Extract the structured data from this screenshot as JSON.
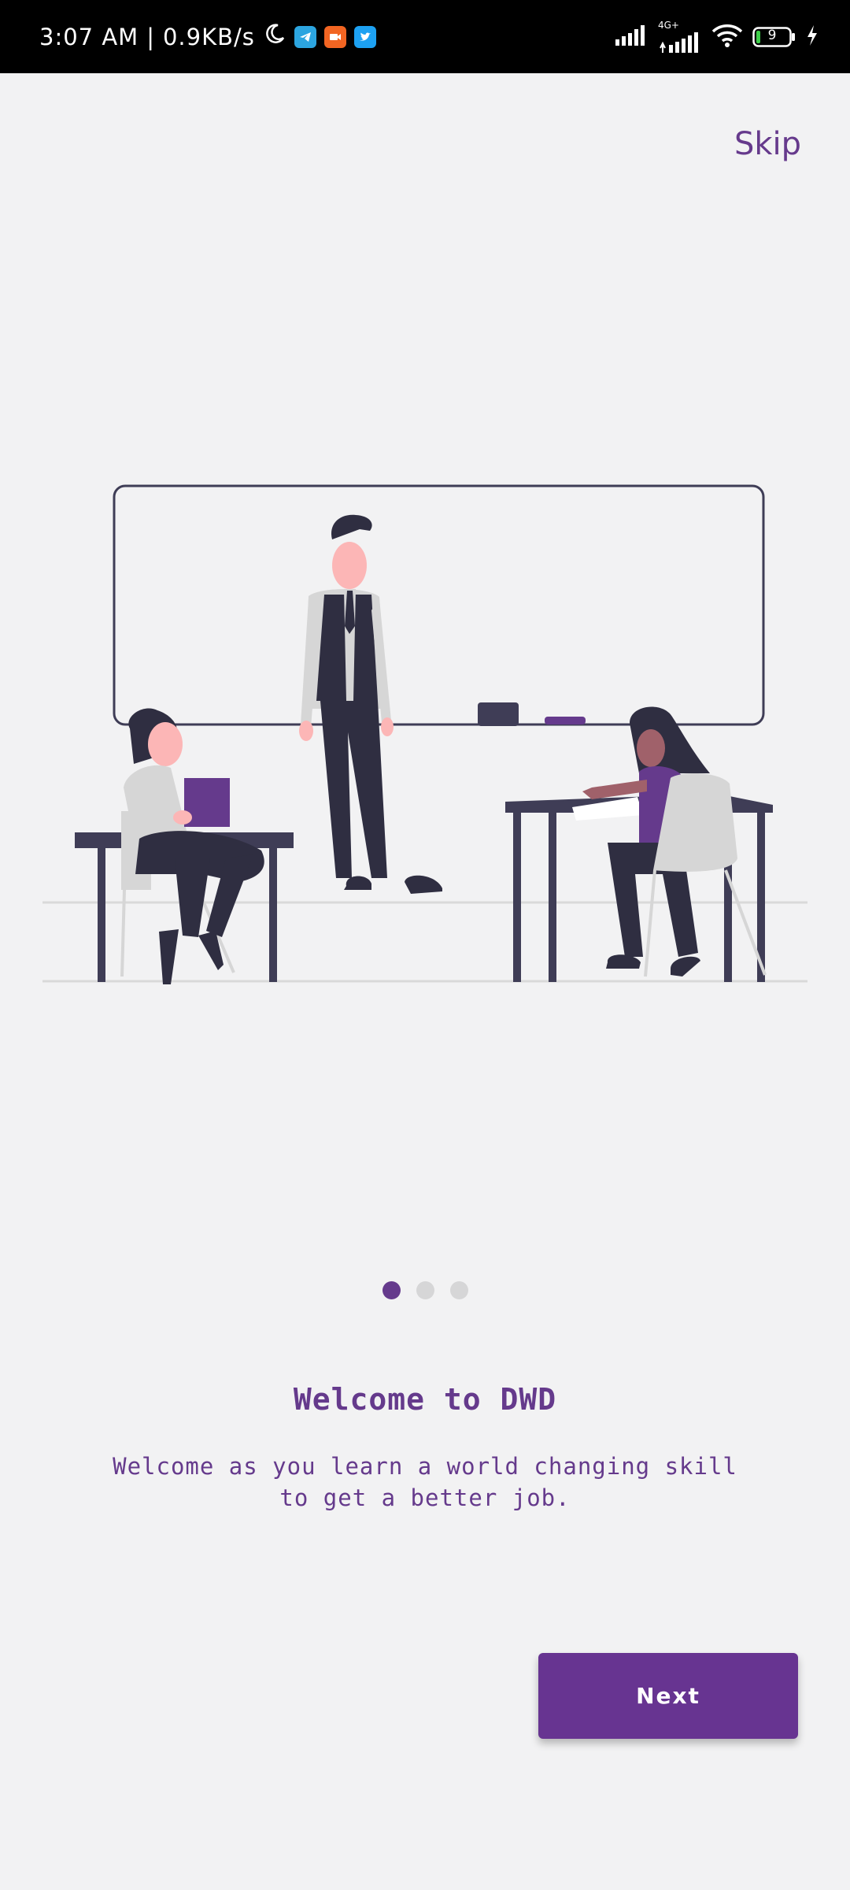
{
  "status_bar": {
    "time": "3:07 AM",
    "separator": "|",
    "network_speed": "0.9KB/s",
    "icons": [
      "moon-icon",
      "telegram-icon",
      "video-app-icon",
      "twitter-icon",
      "signal-icon",
      "signal-4g-icon",
      "wifi-icon",
      "battery-icon",
      "charging-icon"
    ],
    "network_type": "4G+",
    "battery_level": "9"
  },
  "onboarding": {
    "skip_label": "Skip",
    "title": "Welcome to DWD",
    "subtitle_line1": "Welcome as you learn a world changing skill",
    "subtitle_line2": "to get a better job.",
    "next_label": "Next",
    "page_indicator": {
      "current": 1,
      "total": 3
    }
  },
  "colors": {
    "accent": "#653a8c",
    "button": "#673491",
    "background": "#f2f2f3",
    "dark_figure": "#2f2e41",
    "inactive_dot": "#d6d6d7"
  }
}
